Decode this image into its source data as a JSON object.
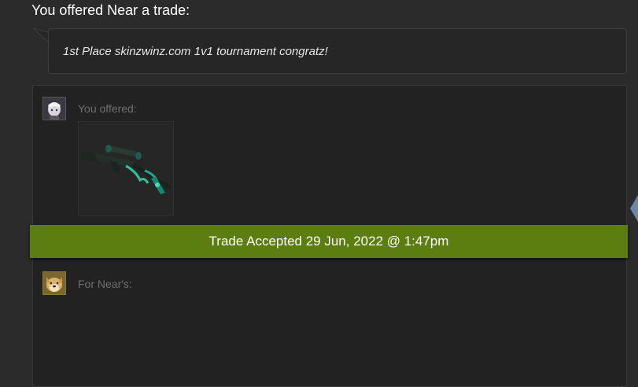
{
  "header": {
    "title": "You offered Near a trade:"
  },
  "message": {
    "text": "1st Place skinzwinz.com 1v1 tournament congratz!"
  },
  "trade": {
    "you_label": "You offered:",
    "them_label": "For Near's:",
    "offered_item_icon": "awp-sniper-rifle-icon",
    "status_text": "Trade Accepted 29 Jun, 2022 @ 1:47pm",
    "status_color": "#5c7e10"
  }
}
